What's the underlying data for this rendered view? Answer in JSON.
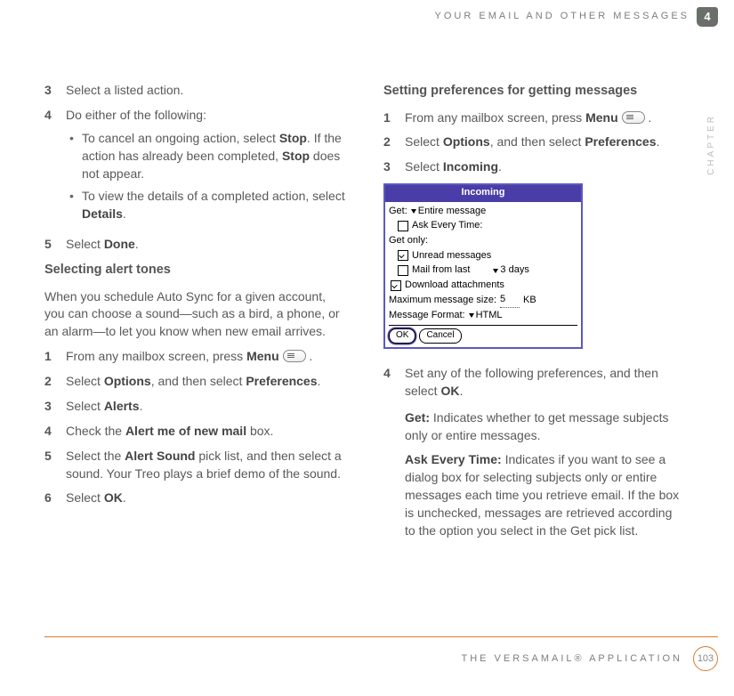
{
  "header": {
    "section": "YOUR EMAIL AND OTHER MESSAGES",
    "chapter_num": "4",
    "chapter_word": "CHAPTER"
  },
  "footer": {
    "app": "THE VERSAMAIL® APPLICATION",
    "page": "103"
  },
  "left": {
    "s3": "Select a listed action.",
    "s4": "Do either of the following:",
    "s4b1a": "To cancel an ongoing action, select ",
    "s4b1b": "Stop",
    "s4b1c": ". If the action has already been completed, ",
    "s4b1d": "Stop",
    "s4b1e": " does not appear.",
    "s4b2a": "To view the details of a completed action, select ",
    "s4b2b": "Details",
    "s4b2c": ".",
    "s5a": "Select ",
    "s5b": "Done",
    "s5c": ".",
    "h1": "Selecting alert tones",
    "p1": "When you schedule Auto Sync for a given account, you can choose a sound—such as a bird, a phone, or an alarm—to let you know when new email arrives.",
    "t1a": "From any mailbox screen, press ",
    "t1b": "Menu",
    "t2a": "Select ",
    "t2b": "Options",
    "t2c": ", and then select ",
    "t2d": "Preferences",
    "t2e": ".",
    "t3a": "Select ",
    "t3b": "Alerts",
    "t3c": ".",
    "t4a": "Check the ",
    "t4b": "Alert me of new mail",
    "t4c": " box.",
    "t5a": "Select the ",
    "t5b": "Alert Sound",
    "t5c": " pick list, and then select a sound. Your Treo plays a brief demo of the sound.",
    "t6a": "Select ",
    "t6b": "OK",
    "t6c": "."
  },
  "right": {
    "h1": "Setting preferences for getting messages",
    "r1a": "From any mailbox screen, press ",
    "r1b": "Menu",
    "r2a": "Select ",
    "r2b": "Options",
    "r2c": ", and then select ",
    "r2d": "Preferences",
    "r2e": ".",
    "r3a": "Select ",
    "r3b": "Incoming",
    "r3c": ".",
    "r4a": "Set any of the following preferences, and then select ",
    "r4b": "OK",
    "r4c": ".",
    "g_lbl": "Get:",
    "g_txt": " Indicates whether to get message subjects only or entire messages.",
    "a_lbl": "Ask Every Time:",
    "a_txt": " Indicates if you want to see a dialog box for selecting subjects only or entire messages each time you retrieve email. If the box is unchecked, messages are retrieved according to the option you select in the Get pick list."
  },
  "palm": {
    "title": "Incoming",
    "get": "Get:",
    "get_val": "Entire message",
    "ask": "Ask Every Time:",
    "getonly": "Get only:",
    "unread": "Unread messages",
    "mailfrom": "Mail from last",
    "days": "3 days",
    "dl": "Download attachments",
    "maxsize": "Maximum message size:",
    "size": "5",
    "kb": "KB",
    "fmt": "Message Format:",
    "fmt_val": "HTML",
    "ok": "OK",
    "cancel": "Cancel"
  }
}
